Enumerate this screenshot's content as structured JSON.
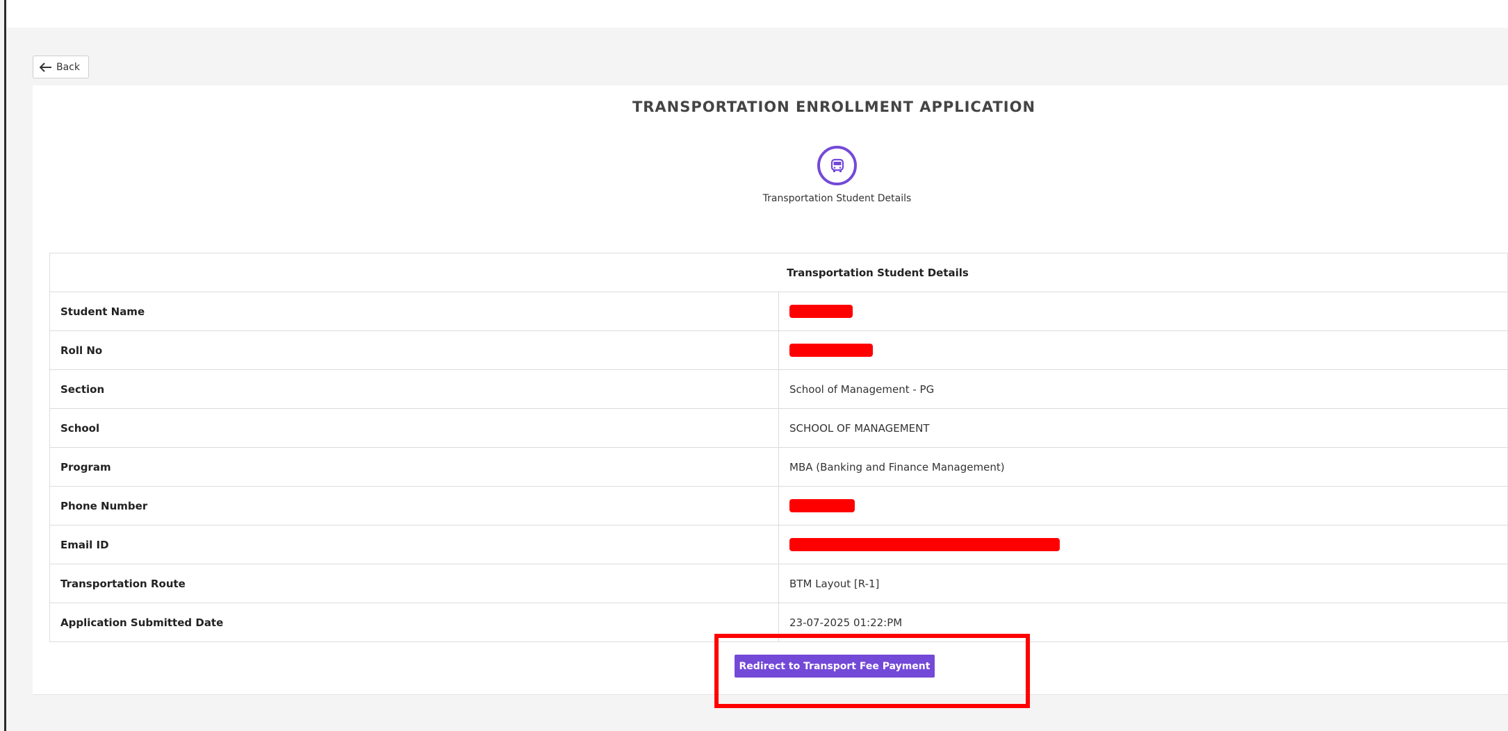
{
  "header": {
    "back_label": "Back"
  },
  "page": {
    "title": "TRANSPORTATION ENROLLMENT APPLICATION",
    "step_icon": "bus-icon",
    "step_label": "Transportation Student Details"
  },
  "details_table": {
    "heading": "Transportation Student Details",
    "rows": [
      {
        "label": "Student Name",
        "value": "",
        "redacted": true
      },
      {
        "label": "Roll No",
        "value": "",
        "redacted": true
      },
      {
        "label": "Section",
        "value": "School of Management - PG"
      },
      {
        "label": "School",
        "value": "SCHOOL OF MANAGEMENT"
      },
      {
        "label": "Program",
        "value": "MBA (Banking and Finance Management)"
      },
      {
        "label": "Phone Number",
        "value": "",
        "redacted": true
      },
      {
        "label": "Email ID",
        "value": "",
        "redacted": true
      },
      {
        "label": "Transportation Route",
        "value": "BTM Layout [R-1]"
      },
      {
        "label": "Application Submitted Date",
        "value": "23-07-2025 01:22:PM"
      }
    ]
  },
  "actions": {
    "payment_button_label": "Redirect to Transport Fee Payment"
  },
  "colors": {
    "accent": "#7349d8",
    "highlight": "#ff0000",
    "redaction": "#ff0000"
  }
}
